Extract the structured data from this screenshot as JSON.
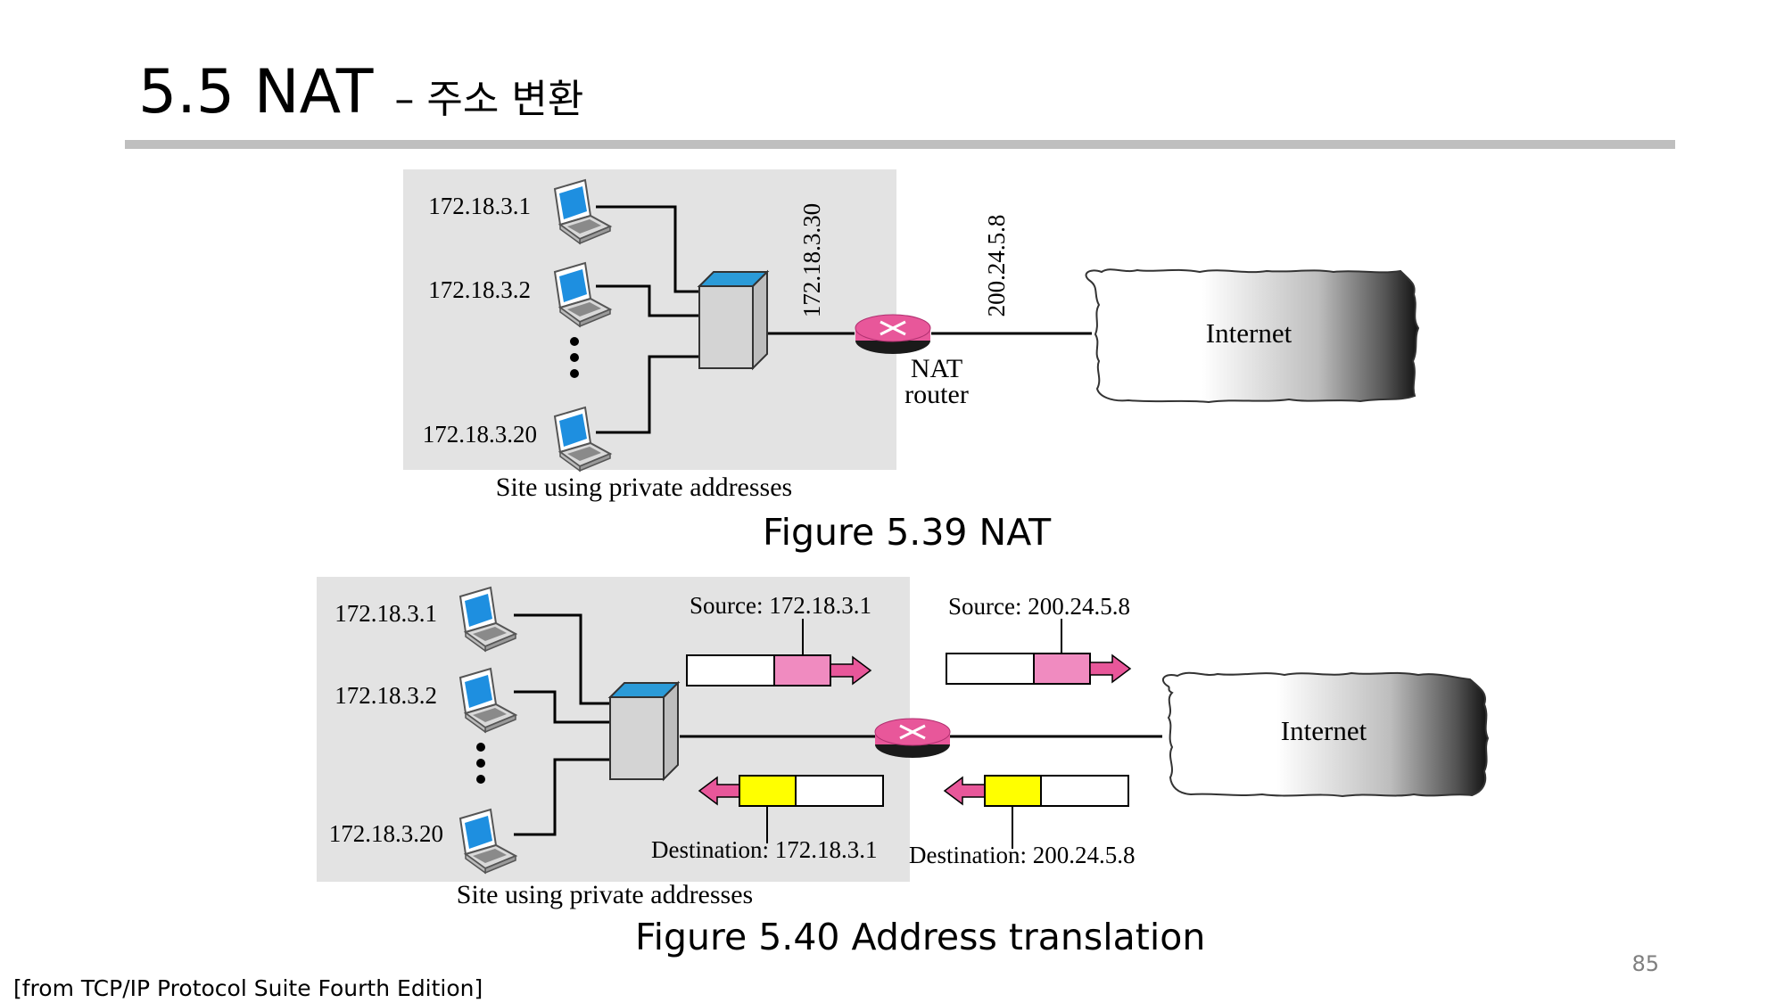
{
  "slide": {
    "title": "5.5 NAT",
    "subtitle": "– 주소 변환",
    "page_number": "85",
    "source_note": "[from TCP/IP Protocol Suite Fourth Edition]"
  },
  "figure1": {
    "caption": "Figure 5.39 NAT",
    "hosts": [
      "172.18.3.1",
      "172.18.3.2",
      "172.18.3.20"
    ],
    "private_router_ip": "172.18.3.30",
    "public_ip": "200.24.5.8",
    "router_label_line1": "NAT",
    "router_label_line2": "router",
    "cloud_label": "Internet",
    "site_label": "Site using private addresses"
  },
  "figure2": {
    "caption": "Figure 5.40 Address translation",
    "hosts": [
      "172.18.3.1",
      "172.18.3.2",
      "172.18.3.20"
    ],
    "source_inside": "Source: 172.18.3.1",
    "source_outside": "Source: 200.24.5.8",
    "dest_inside": "Destination: 172.18.3.1",
    "dest_outside": "Destination: 200.24.5.8",
    "cloud_label": "Internet",
    "site_label": "Site using private addresses"
  },
  "colors": {
    "site_background": "#e3e3e3",
    "router": "#e8579a",
    "source_field": "#f08bc0",
    "destination_field": "#ffff00",
    "switch_top": "#2b9bd8",
    "rule": "#bfbfbf"
  },
  "icons": [
    "laptop-icon",
    "switch-icon",
    "router-icon",
    "cloud-icon",
    "arrow-icon"
  ]
}
